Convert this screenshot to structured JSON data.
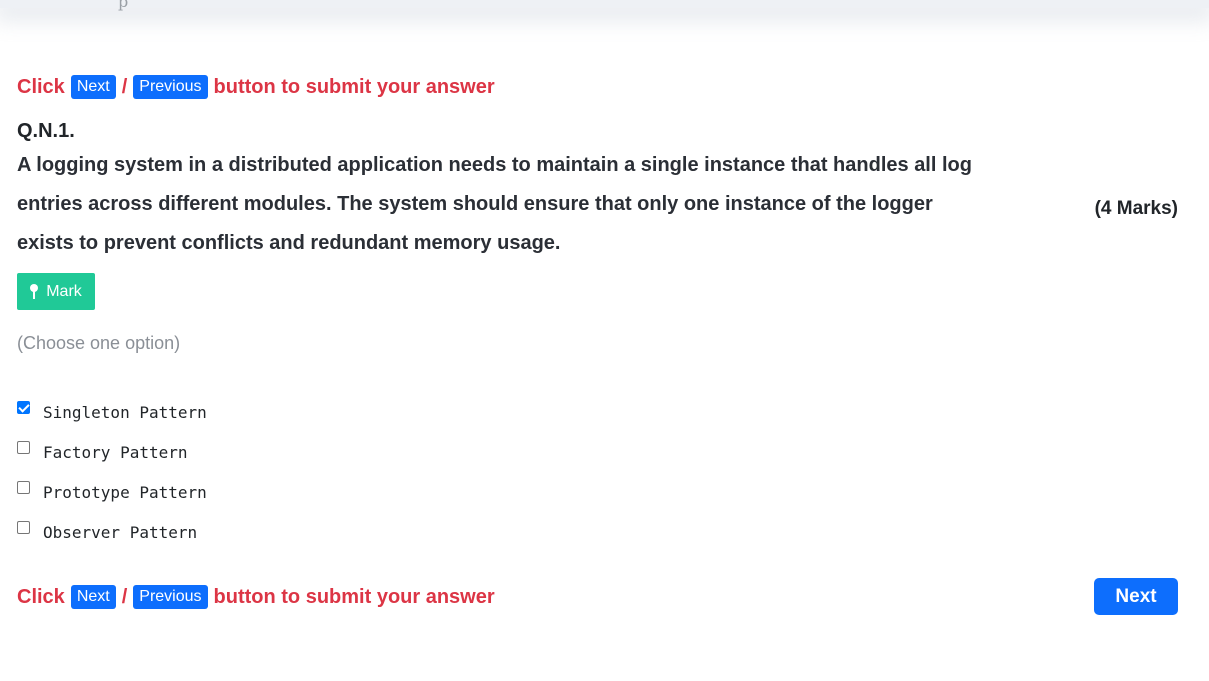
{
  "header": {
    "cut_text": "p"
  },
  "instruction": {
    "lead": "Click",
    "next_label": "Next",
    "separator": "/",
    "previous_label": "Previous",
    "tail": "button to submit your answer"
  },
  "question": {
    "number": "Q.N.1.",
    "text": "A logging system in a distributed application needs to maintain a single instance that handles all log entries across different modules. The system should ensure that only one instance of the logger exists to prevent conflicts and redundant memory usage.",
    "marks": "(4 Marks)"
  },
  "mark_button": {
    "label": "Mark",
    "icon": "pin-icon"
  },
  "choose_hint": "(Choose one option)",
  "options": [
    {
      "label": "Singleton Pattern",
      "checked": true
    },
    {
      "label": "Factory Pattern",
      "checked": false
    },
    {
      "label": "Prototype Pattern",
      "checked": false
    },
    {
      "label": "Observer Pattern",
      "checked": false
    }
  ],
  "nav": {
    "next_label": "Next"
  },
  "colors": {
    "accent_red": "#dc3545",
    "primary_blue": "#0d6efd",
    "mark_green": "#20c997"
  }
}
